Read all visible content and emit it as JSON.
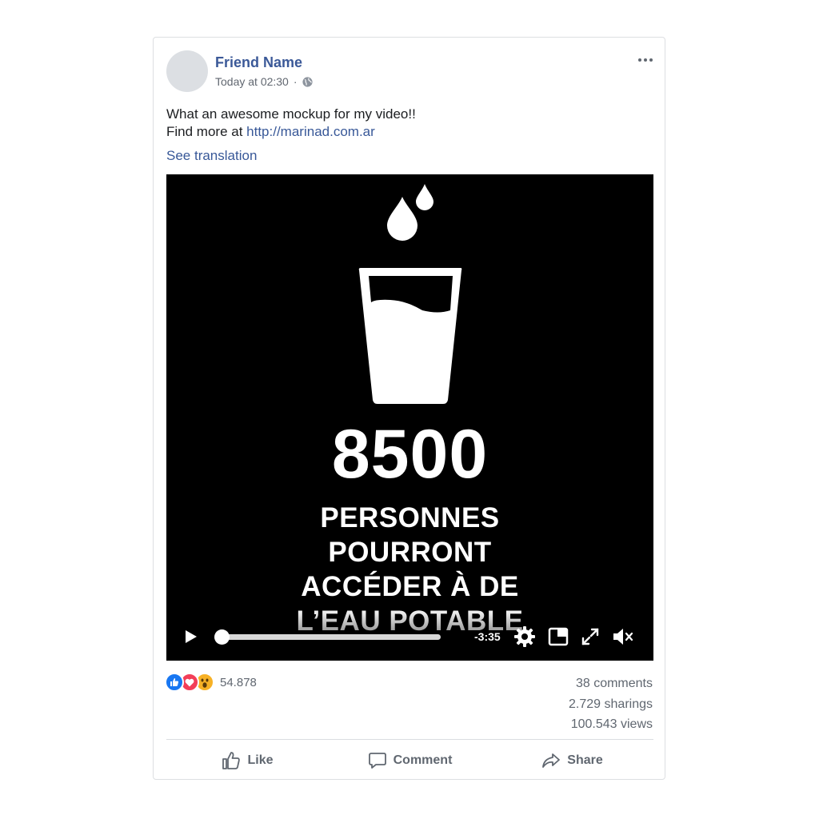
{
  "post": {
    "author": "Friend Name",
    "timestamp": "Today at 02:30",
    "separator": "·",
    "privacy_icon": "globe-icon",
    "more_icon": "more-options-icon",
    "text_line1": "What an awesome mockup for my video!!",
    "text_line2_prefix": "Find more at ",
    "link": "http://marinad.com.ar",
    "see_translation": "See translation"
  },
  "video": {
    "headline_number": "8500",
    "caption_lines": [
      "PERSONNES",
      "POURRONT",
      "ACCÉDER À DE",
      "L’EAU POTABLE"
    ],
    "time_remaining": "-3:35",
    "progress": 0.0,
    "muted": true
  },
  "engagement": {
    "reaction_icons": [
      "like-reaction-icon",
      "love-reaction-icon",
      "wow-reaction-icon"
    ],
    "reaction_count": "54.878",
    "comments": "38 comments",
    "sharings": "2.729 sharings",
    "views": "100.543 views"
  },
  "actions": {
    "like": "Like",
    "comment": "Comment",
    "share": "Share"
  },
  "colors": {
    "link": "#385898",
    "author": "#3b5998",
    "like_blue": "#1877f2",
    "love_red": "#f33e58",
    "wow_yellow": "#f7b125"
  }
}
